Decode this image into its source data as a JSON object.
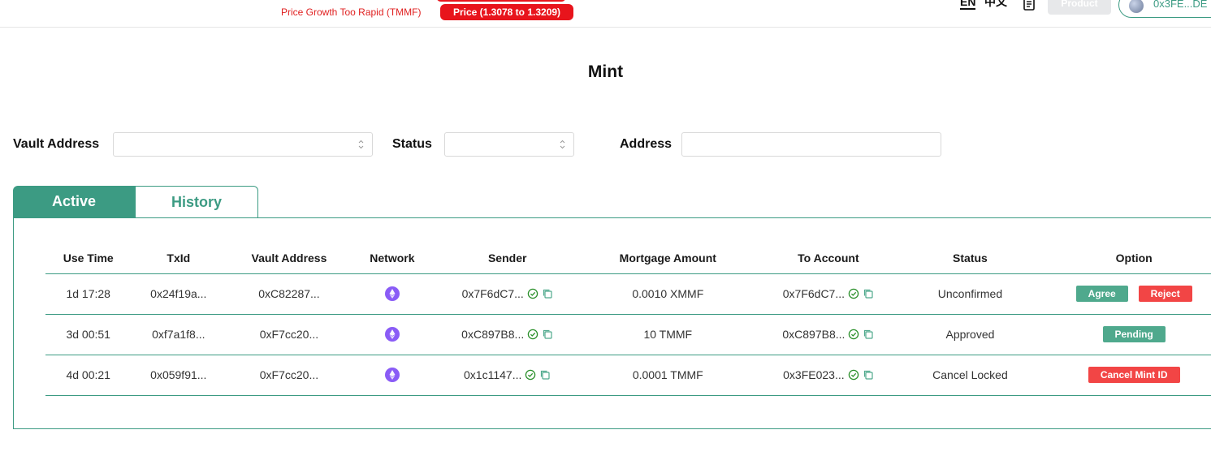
{
  "topbar": {
    "alert_text": "Price Growth Too Rapid (TMMF)",
    "alert_pill": "Price (1.3078 to 1.3209)",
    "lang_en": "EN",
    "lang_zh": "中文",
    "product_label": "Product",
    "wallet_address": "0x3FE...DE"
  },
  "page": {
    "title": "Mint"
  },
  "filters": {
    "vault_label": "Vault Address",
    "vault_value": "",
    "status_label": "Status",
    "status_value": "",
    "address_label": "Address",
    "address_placeholder": ""
  },
  "tabs": {
    "active": "Active",
    "history": "History"
  },
  "table": {
    "headers": [
      "Use Time",
      "TxId",
      "Vault Address",
      "Network",
      "Sender",
      "Mortgage Amount",
      "To Account",
      "Status",
      "Option"
    ],
    "rows": [
      {
        "use_time": "1d 17:28",
        "txid": "0x24f19a...",
        "vault": "0xC82287...",
        "network": "ethereum-icon",
        "sender": "0x7F6dC7...",
        "amount": "0.0010 XMMF",
        "to_account": "0x7F6dC7...",
        "status": "Unconfirmed",
        "options": [
          "Agree",
          "Reject"
        ]
      },
      {
        "use_time": "3d 00:51",
        "txid": "0xf7a1f8...",
        "vault": "0xF7cc20...",
        "network": "ethereum-icon",
        "sender": "0xC897B8...",
        "amount": "10 TMMF",
        "to_account": "0xC897B8...",
        "status": "Approved",
        "options": [
          "Pending"
        ]
      },
      {
        "use_time": "4d 00:21",
        "txid": "0x059f91...",
        "vault": "0xF7cc20...",
        "network": "ethereum-icon",
        "sender": "0x1c1147...",
        "amount": "0.0001 TMMF",
        "to_account": "0x3FE023...",
        "status": "Cancel Locked",
        "options": [
          "Cancel Mint ID"
        ]
      }
    ]
  },
  "colors": {
    "accent": "#3c9b83",
    "danger": "#f24545",
    "alert": "#e8141c",
    "eth": "#8a5cf6"
  }
}
